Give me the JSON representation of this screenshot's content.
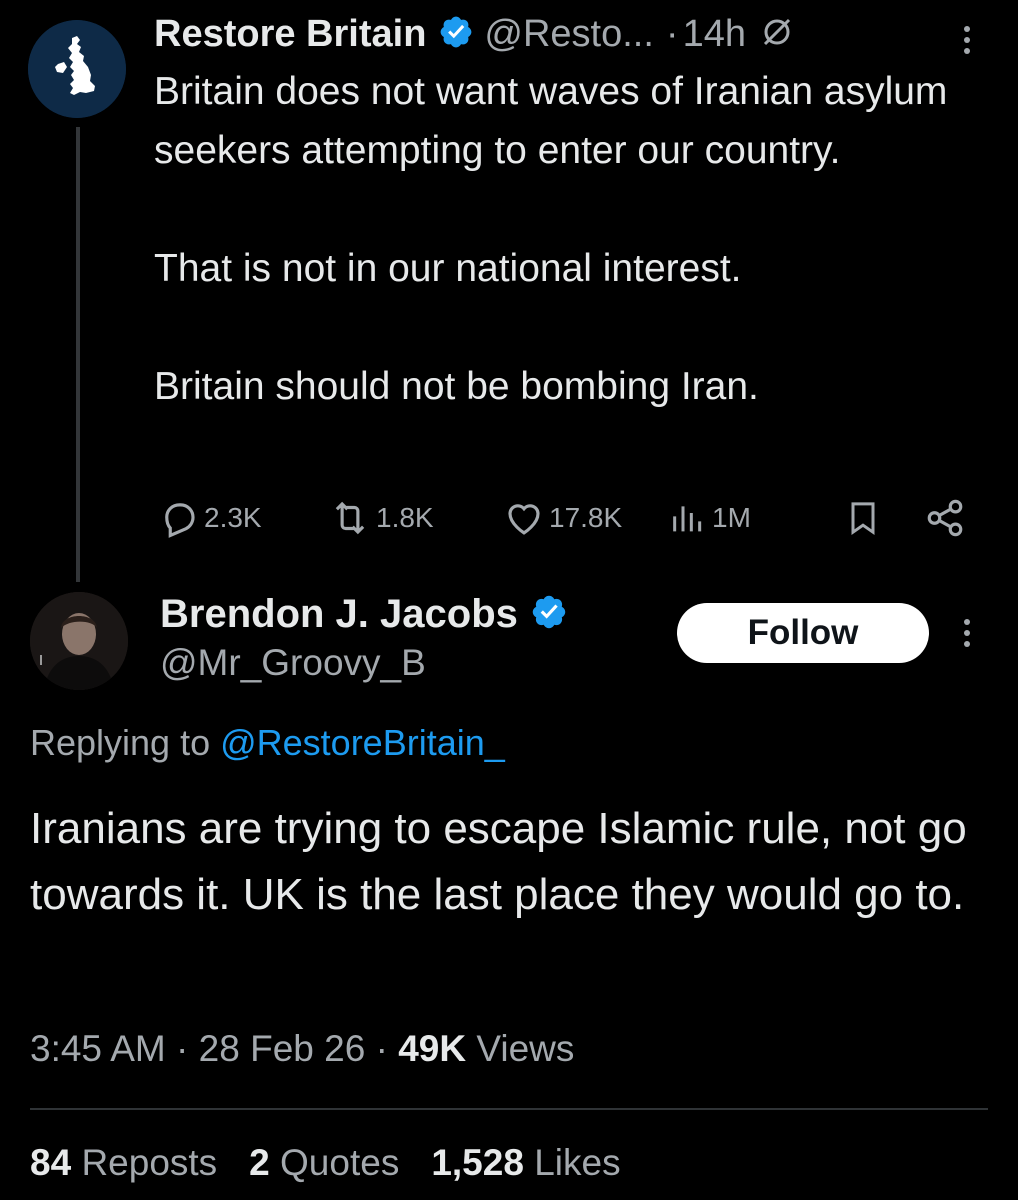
{
  "parent_tweet": {
    "author_name": "Restore Britain",
    "handle": "@Resto...",
    "separator": "·",
    "time": "14h",
    "text_paragraphs": [
      "Britain does not want waves of Iranian asylum seekers attempting to enter our country.",
      "That is not in our national interest.",
      "Britain should not be bombing Iran."
    ],
    "actions": {
      "replies": "2.3K",
      "reposts": "1.8K",
      "likes": "17.8K",
      "views": "1M"
    },
    "icons": [
      "verified-badge-icon",
      "no-edit-icon",
      "more-icon",
      "reply-icon",
      "repost-icon",
      "like-icon",
      "views-icon",
      "bookmark-icon",
      "share-icon"
    ]
  },
  "reply_tweet": {
    "author_name": "Brendon J. Jacobs",
    "handle": "@Mr_Groovy_B",
    "follow_label": "Follow",
    "replying_prefix": "Replying to ",
    "replying_mention": "@RestoreBritain_",
    "text": "Iranians are trying to escape Islamic rule, not go towards it. UK is the last place they would go to.",
    "meta": {
      "time": "3:45 AM",
      "separator": "·",
      "date": "28 Feb 26",
      "views_count": "49K",
      "views_label": "Views"
    },
    "stats": {
      "reposts_count": "84",
      "reposts_label": "Reposts",
      "quotes_count": "2",
      "quotes_label": "Quotes",
      "likes_count": "1,528",
      "likes_label": "Likes"
    }
  },
  "colors": {
    "background": "#000000",
    "primary_text": "#e7e9ea",
    "secondary_text": "#a4a9ae",
    "accent_blue": "#1d9bf0",
    "divider": "#2f3336",
    "follow_button_bg": "#ffffff"
  }
}
